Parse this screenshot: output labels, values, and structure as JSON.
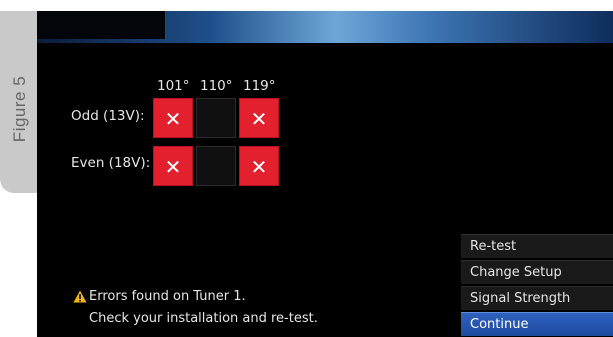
{
  "figure_label": "Figure 5",
  "satellites": [
    "101°",
    "110°",
    "119°"
  ],
  "rows": [
    {
      "label": "Odd (13V):",
      "cells": [
        "error",
        "empty",
        "error"
      ]
    },
    {
      "label": "Even (18V):",
      "cells": [
        "error",
        "empty",
        "error"
      ]
    }
  ],
  "error_mark": "✕",
  "message": {
    "line1": "Errors found on Tuner 1.",
    "line2": "Check your installation and re-test."
  },
  "menu": [
    "Re-test",
    "Change Setup",
    "Signal Strength",
    "Continue"
  ],
  "selected_menu": "Continue",
  "colors": {
    "error": "#e3202e",
    "selected": "#2a5cb8",
    "warning": "#f2b318"
  }
}
